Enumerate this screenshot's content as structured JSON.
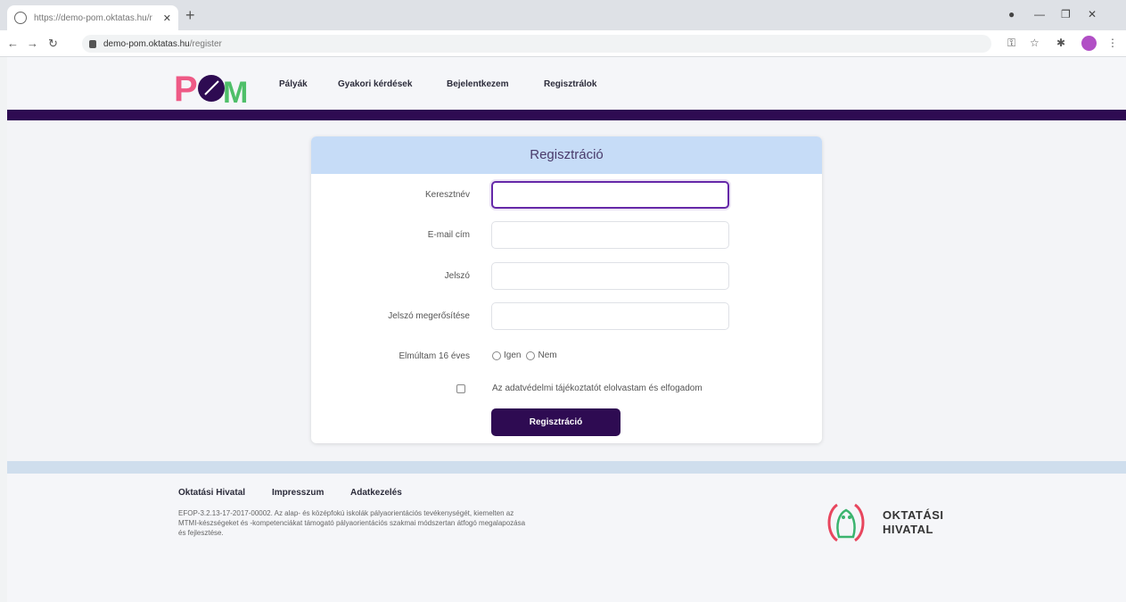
{
  "browser": {
    "tab_title": "https://demo-pom.oktatas.hu/r",
    "url_host": "demo-pom.oktatas.hu",
    "url_path": "/register"
  },
  "header": {
    "logo_text": "POM",
    "nav": [
      "Pályák",
      "Gyakori kérdések",
      "Bejelentkezem",
      "Regisztrálok"
    ]
  },
  "form": {
    "title": "Regisztráció",
    "fields": [
      {
        "label": "Keresztnév",
        "value": ""
      },
      {
        "label": "E-mail cím",
        "value": ""
      },
      {
        "label": "Jelszó",
        "value": ""
      },
      {
        "label": "Jelszó megerősítése",
        "value": ""
      }
    ],
    "age_label": "Elmúltam 16 éves",
    "age_options": [
      "Igen",
      "Nem"
    ],
    "consent_label": "Az adatvédelmi tájékoztatót elolvastam és elfogadom",
    "submit_label": "Regisztráció"
  },
  "footer": {
    "links": [
      "Oktatási Hivatal",
      "Impresszum",
      "Adatkezelés"
    ],
    "text": "EFOP-3.2.13-17-2017-00002. Az alap- és középfokú iskolák pályaorientációs tevékenységét, kiemelten az MTMI-készségeket és -kompetenciákat támogató pályaorientációs szakmai módszertan átfogó megalapozása és fejlesztése.",
    "logo_line1": "OKTATÁSI",
    "logo_line2": "HIVATAL"
  },
  "colors": {
    "brand_dark": "#2e0b52",
    "card_header": "#c6dcf7",
    "focus": "#6528a8"
  }
}
